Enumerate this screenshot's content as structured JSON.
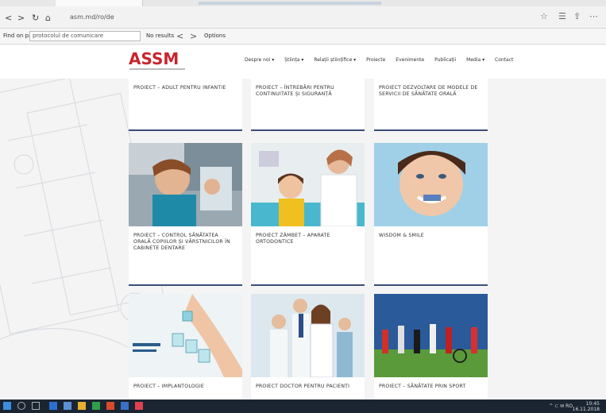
{
  "browser": {
    "back": "<",
    "forward": ">",
    "refresh": "↻",
    "home": "⌂",
    "address": "asm.md/ro/de",
    "star": "☆",
    "reading": "☰",
    "share": "⇪",
    "more": "⋯"
  },
  "findbar": {
    "label": "Find on page",
    "query": "protocolul de comunicare",
    "result": "No results",
    "prev": "<",
    "next": ">",
    "options": "Options"
  },
  "site": {
    "logo": "ASSM",
    "nav": [
      "Despre noi ▾",
      "Știința ▾",
      "Relații științifice ▾",
      "Proiecte",
      "Evenimente",
      "Publicații",
      "Media ▾",
      "Contact"
    ]
  },
  "cards": [
    {
      "caption": "PROIECT – ADULT PENTRU INFANTIE"
    },
    {
      "caption": "PROIECT – ÎNTREBĂRI PENTRU CONTINUITATE ȘI SIGURANȚĂ"
    },
    {
      "caption": "PROIECT DEZVOLTARE DE MODELE DE SERVICII DE SĂNĂTATE ORALĂ"
    },
    {
      "caption": "PROIECT – CONTROL SĂNĂTATEA ORALĂ COPIILOR ȘI VĂRSTNICILOR ÎN CABINETE DENTARE"
    },
    {
      "caption": "PROIECT ZÂMBET – APARATE ORTODONTICE"
    },
    {
      "caption": "WISDOM & SMILE"
    },
    {
      "caption": "PROIECT – IMPLANTOLOGIE"
    },
    {
      "caption": "PROIECT DOCTOR PENTRU PACIENȚI"
    },
    {
      "caption": "PROIECT – SĂNĂTATE PRIN SPORT"
    }
  ],
  "colors": {
    "logo": "#c8252e",
    "card_border": "#3a4e78",
    "taskbar": "#1b2532"
  },
  "taskbar": {
    "clock_time": "10:45",
    "clock_date": "16.11.2018",
    "tray": "^ ⊂ ✉ RO"
  }
}
